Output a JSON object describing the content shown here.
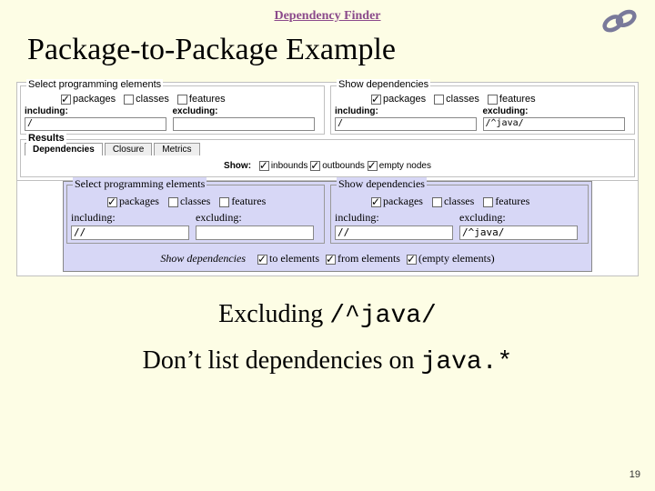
{
  "header": {
    "title": "Dependency Finder"
  },
  "slide_title": "Package-to-Package Example",
  "panel_top": {
    "left": {
      "legend": "Select programming elements",
      "cb": {
        "packages": "packages",
        "classes": "classes",
        "features": "features"
      },
      "checked": {
        "packages": true,
        "classes": false,
        "features": false
      },
      "including": "including:",
      "excluding": "excluding:",
      "inc_val": "/",
      "exc_val": ""
    },
    "right": {
      "legend": "Show dependencies",
      "cb": {
        "packages": "packages",
        "classes": "classes",
        "features": "features"
      },
      "checked": {
        "packages": true,
        "classes": false,
        "features": false
      },
      "including": "including:",
      "excluding": "excluding:",
      "inc_val": "/",
      "exc_val": "/^java/"
    },
    "results_legend": "Results",
    "tabs": {
      "dependencies": "Dependencies",
      "closure": "Closure",
      "metrics": "Metrics"
    },
    "show": {
      "label": "Show:",
      "inbounds": "inbounds",
      "outbounds": "outbounds",
      "empty": "empty nodes"
    }
  },
  "panel_blue": {
    "left": {
      "legend": "Select programming elements",
      "cb": {
        "packages": "packages",
        "classes": "classes",
        "features": "features"
      },
      "checked": {
        "packages": true,
        "classes": false,
        "features": false
      },
      "including": "including:",
      "excluding": "excluding:",
      "inc_val": "//",
      "exc_val": ""
    },
    "right": {
      "legend": "Show dependencies",
      "cb": {
        "packages": "packages",
        "classes": "classes",
        "features": "features"
      },
      "checked": {
        "packages": true,
        "classes": false,
        "features": false
      },
      "including": "including:",
      "excluding": "excluding:",
      "inc_val": "//",
      "exc_val": "/^java/"
    },
    "show": {
      "label": "Show dependencies",
      "to": "to elements",
      "from": "from elements",
      "empty": "(empty elements)"
    }
  },
  "callout1": {
    "pre": "Excluding ",
    "code": "/^java/"
  },
  "callout2": {
    "pre": "Don’t list dependencies on ",
    "code": "java.*"
  },
  "page_num": "19"
}
